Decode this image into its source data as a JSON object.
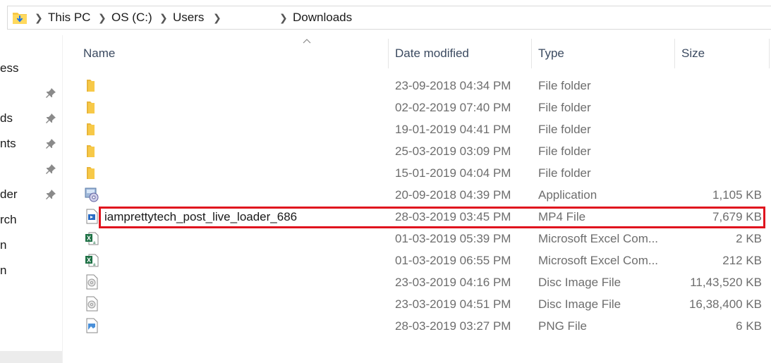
{
  "address": {
    "crumbs": [
      "This PC",
      "OS (C:)",
      "Users",
      "Downloads"
    ]
  },
  "nav": {
    "items": [
      "ess",
      "",
      "ds",
      "nts",
      "",
      "der",
      "rch",
      "n",
      "n"
    ]
  },
  "columns": {
    "name": "Name",
    "date": "Date modified",
    "type": "Type",
    "size": "Size"
  },
  "files": [
    {
      "name": "",
      "date": "23-09-2018 04:34 PM",
      "type": "File folder",
      "size": "",
      "icon": "folder-icon"
    },
    {
      "name": "",
      "date": "02-02-2019 07:40 PM",
      "type": "File folder",
      "size": "",
      "icon": "folder-icon"
    },
    {
      "name": "",
      "date": "19-01-2019 04:41 PM",
      "type": "File folder",
      "size": "",
      "icon": "folder-icon"
    },
    {
      "name": "",
      "date": "25-03-2019 03:09 PM",
      "type": "File folder",
      "size": "",
      "icon": "folder-icon"
    },
    {
      "name": "",
      "date": "15-01-2019 04:04 PM",
      "type": "File folder",
      "size": "",
      "icon": "folder-icon"
    },
    {
      "name": "",
      "date": "20-09-2018 04:39 PM",
      "type": "Application",
      "size": "1,105 KB",
      "icon": "installer-icon"
    },
    {
      "name": "iamprettytech_post_live_loader_686",
      "date": "28-03-2019 03:45 PM",
      "type": "MP4 File",
      "size": "7,679 KB",
      "icon": "video-file-icon"
    },
    {
      "name": "",
      "date": "01-03-2019 05:39 PM",
      "type": "Microsoft Excel Com...",
      "size": "2 KB",
      "icon": "excel-icon"
    },
    {
      "name": "",
      "date": "01-03-2019 06:55 PM",
      "type": "Microsoft Excel Com...",
      "size": "212 KB",
      "icon": "excel-icon"
    },
    {
      "name": "",
      "date": "23-03-2019 04:16 PM",
      "type": "Disc Image File",
      "size": "11,43,520 KB",
      "icon": "disc-image-icon"
    },
    {
      "name": "",
      "date": "23-03-2019 04:51 PM",
      "type": "Disc Image File",
      "size": "16,38,400 KB",
      "icon": "disc-image-icon"
    },
    {
      "name": "",
      "date": "28-03-2019 03:27 PM",
      "type": "PNG File",
      "size": "6 KB",
      "icon": "image-file-icon"
    }
  ],
  "colors": {
    "highlight": "#e0141e",
    "folder": "#f7c948",
    "header_text": "#3b4a60"
  }
}
